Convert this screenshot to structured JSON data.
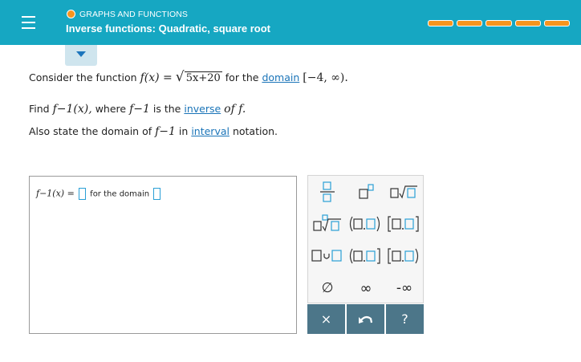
{
  "header": {
    "category": "GRAPHS AND FUNCTIONS",
    "topic": "Inverse functions: Quadratic, square root",
    "progress_segments": 5,
    "accent_color": "#16a7c2",
    "progress_color": "#f7941d"
  },
  "icons": {
    "menu": "hamburger-icon",
    "status": "status-dot-icon",
    "toggle": "chevron-down-icon"
  },
  "problem": {
    "intro": "Consider the function",
    "function_lhs": "f(x) =",
    "radicand": "5x+20",
    "for_the": "for the",
    "domain_link": "domain",
    "interval": "[−4, ∞).",
    "find": "Find",
    "finv_x": "f−1(x),",
    "where": "where",
    "finv": "f−1",
    "is_the": "is the",
    "inverse_link": "inverse",
    "of_f": "of f.",
    "also": "Also state the domain of",
    "in": "in",
    "interval_link": "interval",
    "notation": "notation."
  },
  "answer": {
    "lhs": "f−1(x) =",
    "for_the_domain": "for the domain"
  },
  "keypad": {
    "keys": [
      "fraction",
      "superscript",
      "square-root",
      "nth-root",
      "open-open-interval",
      "closed-closed-interval",
      "union",
      "open-closed-interval",
      "closed-open-interval",
      "empty-set",
      "infinity",
      "negative-infinity"
    ],
    "empty_set": "∅",
    "infinity": "∞",
    "neg_infinity": "-∞",
    "clear": "×",
    "undo": "undo-icon",
    "help": "?"
  }
}
